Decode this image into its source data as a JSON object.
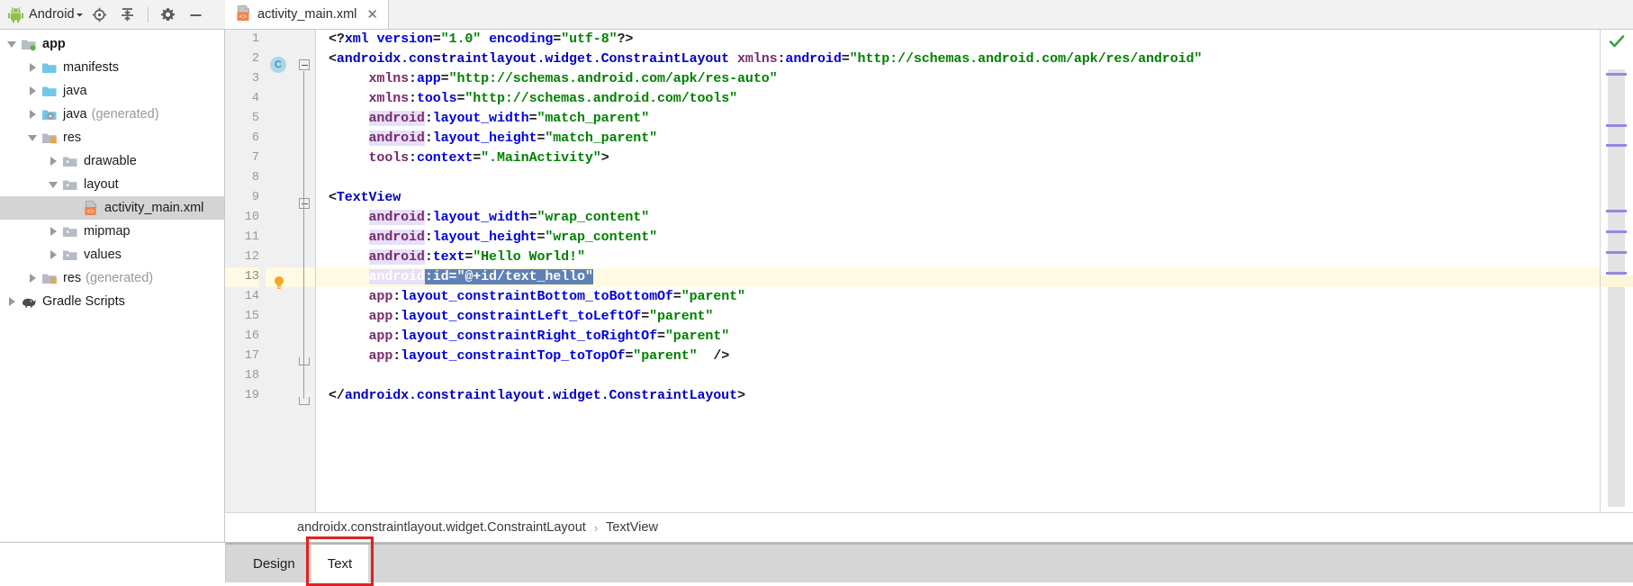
{
  "toolbar": {
    "title": "Android",
    "dropdown_icon": "chevron-down-icon",
    "robot_icon": "android-robot-icon",
    "buttons": [
      {
        "name": "locate-target-icon",
        "label": "Select Opened File"
      },
      {
        "name": "collapse-all-icon",
        "label": "Collapse All"
      },
      {
        "name": "gear-icon",
        "label": "Settings"
      },
      {
        "name": "minimize-icon",
        "label": "Hide"
      }
    ]
  },
  "editor_tab": {
    "filename": "activity_main.xml",
    "icon": "xml-layout-file-icon",
    "close_icon": "close-icon"
  },
  "tree": {
    "items": [
      {
        "label": "app",
        "indent": 0,
        "twisty": "open",
        "icon": "module-folder-icon",
        "bold": true,
        "generated": "",
        "selected": false
      },
      {
        "label": "manifests",
        "indent": 1,
        "twisty": "closed",
        "icon": "blue-folder-icon",
        "bold": false,
        "generated": "",
        "selected": false
      },
      {
        "label": "java",
        "indent": 1,
        "twisty": "closed",
        "icon": "blue-folder-icon",
        "bold": false,
        "generated": "",
        "selected": false
      },
      {
        "label": "java",
        "indent": 1,
        "twisty": "closed",
        "icon": "blue-folder-generated-icon",
        "bold": false,
        "generated": "(generated)",
        "selected": false
      },
      {
        "label": "res",
        "indent": 1,
        "twisty": "open",
        "icon": "res-folder-icon",
        "bold": false,
        "generated": "",
        "selected": false
      },
      {
        "label": "drawable",
        "indent": 2,
        "twisty": "closed",
        "icon": "grey-folder-icon",
        "bold": false,
        "generated": "",
        "selected": false
      },
      {
        "label": "layout",
        "indent": 2,
        "twisty": "open",
        "icon": "grey-folder-icon",
        "bold": false,
        "generated": "",
        "selected": false
      },
      {
        "label": "activity_main.xml",
        "indent": 3,
        "twisty": "none",
        "icon": "xml-layout-file-icon",
        "bold": false,
        "generated": "",
        "selected": true
      },
      {
        "label": "mipmap",
        "indent": 2,
        "twisty": "closed",
        "icon": "grey-folder-icon",
        "bold": false,
        "generated": "",
        "selected": false
      },
      {
        "label": "values",
        "indent": 2,
        "twisty": "closed",
        "icon": "grey-folder-icon",
        "bold": false,
        "generated": "",
        "selected": false
      },
      {
        "label": "res",
        "indent": 1,
        "twisty": "closed",
        "icon": "res-folder-icon",
        "bold": false,
        "generated": "(generated)",
        "selected": false
      },
      {
        "label": "Gradle Scripts",
        "indent": 0,
        "twisty": "closed",
        "icon": "gradle-elephant-icon",
        "bold": false,
        "generated": "",
        "selected": false
      }
    ]
  },
  "code": {
    "gutter_badge": {
      "line": 2,
      "text": "C",
      "name": "class-marker-badge"
    },
    "bulb": {
      "line": 13,
      "name": "intention-bulb-icon"
    },
    "lines": [
      {
        "n": "1",
        "indent": 0,
        "text": "<?xml version=\"1.0\" encoding=\"utf-8\"?>"
      },
      {
        "n": "2",
        "indent": 0,
        "text": "<androidx.constraintlayout.widget.ConstraintLayout xmlns:android=\"http://schemas.android.com/apk/res/android\""
      },
      {
        "n": "3",
        "indent": 1,
        "text": "xmlns:app=\"http://schemas.android.com/apk/res-auto\""
      },
      {
        "n": "4",
        "indent": 1,
        "text": "xmlns:tools=\"http://schemas.android.com/tools\""
      },
      {
        "n": "5",
        "indent": 1,
        "text": "android:layout_width=\"match_parent\""
      },
      {
        "n": "6",
        "indent": 1,
        "text": "android:layout_height=\"match_parent\""
      },
      {
        "n": "7",
        "indent": 1,
        "text": "tools:context=\".MainActivity\">"
      },
      {
        "n": "8",
        "indent": 0,
        "text": ""
      },
      {
        "n": "9",
        "indent": 0,
        "text": "<TextView"
      },
      {
        "n": "10",
        "indent": 1,
        "text": "android:layout_width=\"wrap_content\""
      },
      {
        "n": "11",
        "indent": 1,
        "text": "android:layout_height=\"wrap_content\""
      },
      {
        "n": "12",
        "indent": 1,
        "text": "android:text=\"Hello World!\""
      },
      {
        "n": "13",
        "indent": 1,
        "text": "android:id=\"@+id/text_hello\""
      },
      {
        "n": "14",
        "indent": 1,
        "text": "app:layout_constraintBottom_toBottomOf=\"parent\""
      },
      {
        "n": "15",
        "indent": 1,
        "text": "app:layout_constraintLeft_toLeftOf=\"parent\""
      },
      {
        "n": "16",
        "indent": 1,
        "text": "app:layout_constraintRight_toRightOf=\"parent\""
      },
      {
        "n": "17",
        "indent": 1,
        "text": "app:layout_constraintTop_toTopOf=\"parent\"  />"
      },
      {
        "n": "18",
        "indent": 0,
        "text": ""
      },
      {
        "n": "19",
        "indent": 0,
        "text": "</androidx.constraintlayout.widget.ConstraintLayout>"
      }
    ],
    "selected_line": 13,
    "selected_text": "android:id=\"@+id/text_hello\""
  },
  "markers": {
    "status_icon": "green-checkmark-icon",
    "accent": "#9a86e0"
  },
  "breadcrumb": {
    "root": "androidx.constraintlayout.widget.ConstraintLayout",
    "separator": "›",
    "leaf": "TextView"
  },
  "bottom_tabs": {
    "design": "Design",
    "text": "Text",
    "active": "Text",
    "highlight_color": "#e02020"
  }
}
